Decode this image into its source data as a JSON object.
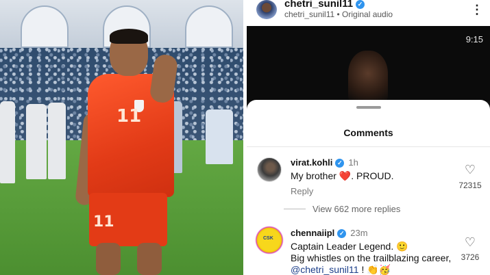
{
  "reel": {
    "username": "chetri_sunil11",
    "audio": "chetri_sunil11 • Original audio",
    "timestamp": "9:15"
  },
  "photo": {
    "jersey_number": "11"
  },
  "comments_sheet": {
    "title": "Comments",
    "view_replies": "View 662 more replies",
    "comments": [
      {
        "username": "virat.kohli",
        "time": "1h",
        "text_before": "My brother ",
        "emoji": "❤️",
        "text_after": ". PROUD.",
        "reply": "Reply",
        "likes": "72315"
      },
      {
        "username": "chennaiipl",
        "time": "23m",
        "line1": "Captain Leader Legend. 🙂",
        "line2": "Big whistles on the trailblazing career,",
        "mention": "@chetri_sunil11",
        "line3_suffix": " ! 👏🥳",
        "likes": "3726"
      }
    ]
  },
  "icons": {
    "verified": "verified-badge-icon",
    "more": "more-options-icon",
    "heart": "heart-icon"
  },
  "colors": {
    "verified_blue": "#2f94ee",
    "jersey_orange": "#e23b17",
    "mention_blue": "#1c3f8a"
  }
}
